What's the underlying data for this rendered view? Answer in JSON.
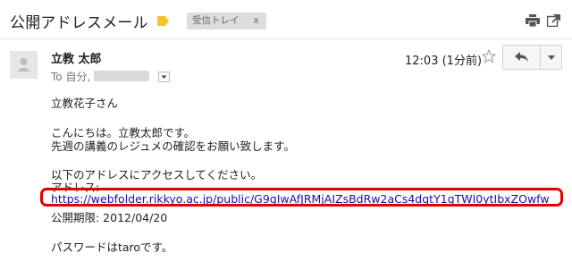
{
  "header": {
    "subject": "公開アドレスメール",
    "inbox_label": "受信トレイ",
    "inbox_remove": "x"
  },
  "message": {
    "sender": "立教 太郎",
    "to_prefix": "To 自分,",
    "time": "12:03 (1分前)"
  },
  "body": {
    "greeting": "立教花子さん",
    "line1": "こんにちは。立教太郎です。",
    "line2": "先週の講義のレジュメの確認をお願い致します。",
    "line3": "以下のアドレスにアクセスしてください。",
    "address_label": "アドレス:",
    "url": "https://webfolder.rikkyo.ac.jp/public/G9gIwAfJRMjAIZsBdRw2aCs4dgtY1qTWI0ytIbxZOwfw",
    "expiry": "公開期限: 2012/04/20",
    "password": "パスワードはtaroです。"
  },
  "colors": {
    "highlight": "#e00000",
    "link": "#1a0dab",
    "label_tag": "#f4c430"
  },
  "icons": [
    "label-tag-icon",
    "print-icon",
    "new-window-icon",
    "avatar-icon",
    "star-icon",
    "reply-icon",
    "dropdown-icon"
  ]
}
